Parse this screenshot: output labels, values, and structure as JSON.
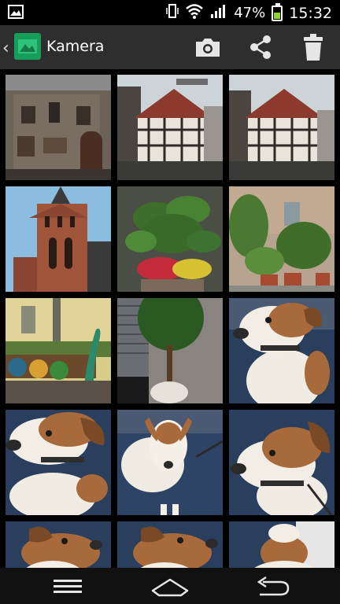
{
  "status_bar": {
    "battery_percent": "47%",
    "time": "15:32",
    "battery_level": 0.47,
    "battery_color": "#8fd23b",
    "icons": [
      "gallery-notification-icon",
      "vibrate-icon",
      "wifi-icon",
      "signal-icon",
      "battery-icon"
    ]
  },
  "action_bar": {
    "title": "Kamera",
    "app_icon": "gallery-app-icon",
    "actions": [
      "camera-icon",
      "share-icon",
      "trash-icon"
    ],
    "background": "#2e2e2e"
  },
  "gallery": {
    "photos": [
      {
        "subject": "stone-building-facade"
      },
      {
        "subject": "half-timbered-house"
      },
      {
        "subject": "half-timbered-house-2"
      },
      {
        "subject": "brick-church-tower"
      },
      {
        "subject": "potted-plant"
      },
      {
        "subject": "garden-plants-wall"
      },
      {
        "subject": "yellow-house-decoration"
      },
      {
        "subject": "topiary-tree"
      },
      {
        "subject": "dog-portrait"
      },
      {
        "subject": "dog-lying"
      },
      {
        "subject": "dog-standing"
      },
      {
        "subject": "dog-close-up"
      },
      {
        "subject": "dog-head-1"
      },
      {
        "subject": "dog-head-2"
      },
      {
        "subject": "dog-head-3"
      }
    ]
  },
  "nav_bar": {
    "buttons": [
      "menu-icon",
      "home-icon",
      "back-icon"
    ]
  }
}
